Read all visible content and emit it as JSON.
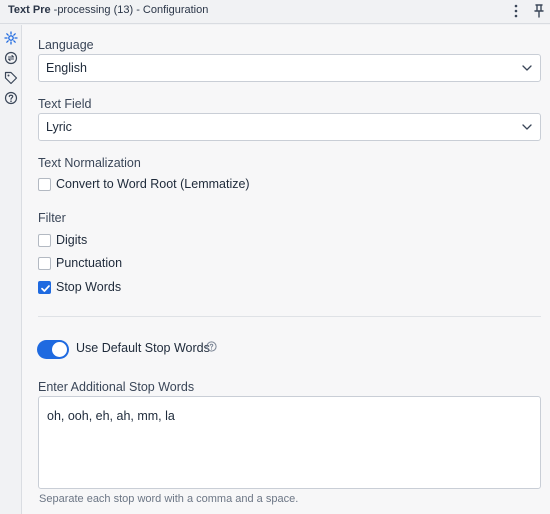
{
  "window": {
    "title_bold": "Text Pre",
    "title_rest": "-processing (13) - Configuration"
  },
  "sidebar": {
    "icons": [
      "gear-icon",
      "exchange-icon",
      "tag-icon",
      "help-icon"
    ]
  },
  "form": {
    "language": {
      "label": "Language",
      "value": "English"
    },
    "text_field": {
      "label": "Text Field",
      "value": "Lyric"
    },
    "normalization": {
      "label": "Text Normalization",
      "lemmatize_label": "Convert to Word Root (Lemmatize)",
      "lemmatize_checked": false
    },
    "filter": {
      "label": "Filter",
      "options": [
        {
          "label": "Digits",
          "checked": false
        },
        {
          "label": "Punctuation",
          "checked": false
        },
        {
          "label": "Stop Words",
          "checked": true
        }
      ]
    },
    "default_stop_words": {
      "label": "Use Default Stop Words",
      "on": true
    },
    "additional_stop_words": {
      "label": "Enter Additional Stop Words",
      "value": "oh, ooh, eh, ah, mm, la",
      "hint": "Separate each stop word with a comma and a space."
    }
  },
  "colors": {
    "accent": "#1f6ae0",
    "panel": "#f7f7f8",
    "titlebar": "#f1f2f4"
  }
}
